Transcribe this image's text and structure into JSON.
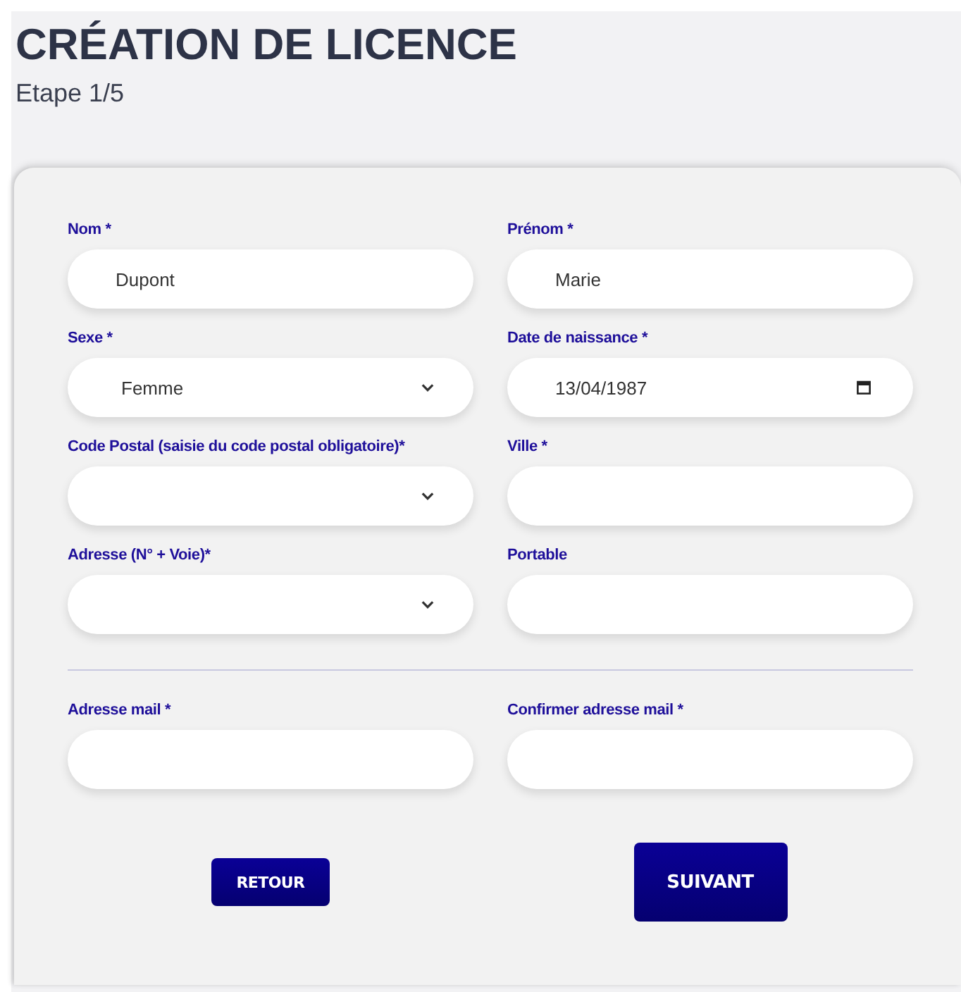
{
  "title": "CRÉATION DE LICENCE",
  "step": "Etape 1/5",
  "sections": [
    {
      "fields": [
        {
          "label": "Nom *",
          "kind": "text",
          "value": "Dupont"
        },
        {
          "label": "Prénom *",
          "kind": "text",
          "value": "Marie"
        },
        {
          "label": "Sexe *",
          "kind": "select",
          "value": "Femme"
        },
        {
          "label": "Date de naissance *",
          "kind": "date",
          "value": "13/04/1987"
        },
        {
          "label": "Code Postal (saisie du code postal obligatoire)*",
          "kind": "select"
        },
        {
          "label": "Ville *",
          "kind": "text"
        },
        {
          "label": "Adresse (N° + Voie)*",
          "kind": "select"
        },
        {
          "label": "Portable",
          "kind": "text"
        }
      ]
    },
    {
      "fields": [
        {
          "label": "Adresse mail *",
          "kind": "text"
        },
        {
          "label": "Confirmer adresse mail *",
          "kind": "text"
        }
      ]
    }
  ],
  "buttons": [
    {
      "label": "RETOUR",
      "kind": "back"
    },
    {
      "label": "SUIVANT",
      "kind": "next"
    }
  ]
}
